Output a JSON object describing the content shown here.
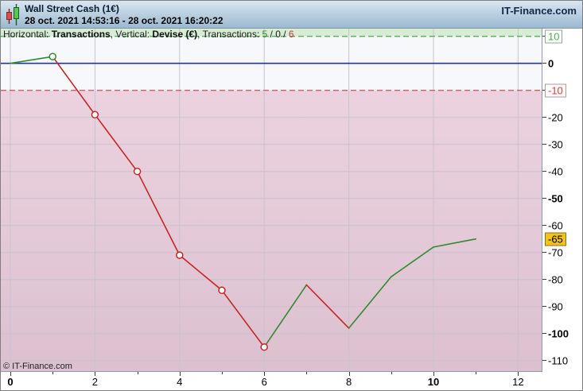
{
  "header": {
    "title": "Wall Street Cash (1€)",
    "date_range": "28 oct. 2021 14:53:16 - 28 oct. 2021 16:20:22",
    "brand": "IT-Finance.com"
  },
  "info_bar": {
    "parts": [
      {
        "text": "Horizontal: ",
        "style": "regular"
      },
      {
        "text": "Transactions",
        "style": "bold"
      },
      {
        "text": ", Vertical: ",
        "style": "regular"
      },
      {
        "text": "Devise (€)",
        "style": "bold"
      },
      {
        "text": ", Transactions: ",
        "style": "regular"
      },
      {
        "text": "5",
        "style": "positive"
      },
      {
        "text": " / ",
        "style": "regular"
      },
      {
        "text": "0",
        "style": "neutral"
      },
      {
        "text": " / ",
        "style": "regular"
      },
      {
        "text": "6",
        "style": "negative"
      }
    ]
  },
  "watermark": "© IT-Finance.com",
  "colors": {
    "band_above_upper": "#d7ecd3",
    "band_middle": "#f6f8fc",
    "band_below_top": "#ecd2df",
    "band_below_bottom": "#dcc0d0",
    "zero_line": "#2232b2",
    "upper_line": "#53b353",
    "lower_line": "#e05c5c",
    "up": "#2e8b2e",
    "down": "#c52525",
    "grid": "#c9c2cc",
    "plot_border": "#8f9aa5",
    "current_value_bg": "#f2c31c",
    "positive_text": "#4cae4c",
    "negative_text": "#cc4444"
  },
  "chart_data": {
    "type": "line",
    "title": "Wall Street Cash (1€)",
    "xlabel": "Transactions",
    "ylabel": "Devise (€)",
    "x": [
      0,
      1,
      2,
      3,
      4,
      5,
      6,
      7,
      8,
      9,
      10,
      11
    ],
    "values": [
      0,
      2.5,
      -19,
      -40,
      -71,
      -84,
      -105,
      -82,
      -98,
      -79,
      -68,
      -65
    ],
    "marker_points": [
      1,
      2,
      3,
      4,
      5,
      6
    ],
    "segment_coloring": "gain-green-loss-red",
    "zero_line": 0,
    "upper_threshold": 10,
    "lower_threshold": -10,
    "current_value": -65,
    "transactions_won": 5,
    "transactions_neutral": 0,
    "transactions_lost": 6,
    "xlim": [
      -0.23,
      12.6
    ],
    "ylim": [
      -114,
      12.9
    ],
    "grid": true,
    "legend": "none",
    "x_gridlines": [
      0,
      2,
      4,
      6,
      8,
      10,
      12
    ],
    "y_gridlines": [
      -20,
      -30,
      -40,
      -50,
      -60,
      -70,
      -80,
      -90,
      -100,
      -110
    ],
    "y_axis_ticks": [
      {
        "label": "10",
        "value": 10,
        "style": "boxed-positive"
      },
      {
        "label": "0",
        "value": 0,
        "style": "bold"
      },
      {
        "label": "-10",
        "value": -10,
        "style": "boxed-negative"
      },
      {
        "label": "-20",
        "value": -20,
        "style": "regular"
      },
      {
        "label": "-30",
        "value": -30,
        "style": "regular"
      },
      {
        "label": "-40",
        "value": -40,
        "style": "regular"
      },
      {
        "label": "-50",
        "value": -50,
        "style": "bold"
      },
      {
        "label": "-60",
        "value": -60,
        "style": "regular"
      },
      {
        "label": "-65",
        "value": -65,
        "style": "current"
      },
      {
        "label": "-70",
        "value": -70,
        "style": "regular"
      },
      {
        "label": "-80",
        "value": -80,
        "style": "regular"
      },
      {
        "label": "-90",
        "value": -90,
        "style": "regular"
      },
      {
        "label": "-100",
        "value": -100,
        "style": "bold"
      },
      {
        "label": "-110",
        "value": -110,
        "style": "regular"
      }
    ],
    "x_axis_ticks": [
      {
        "label": "0",
        "value": 0,
        "style": "bold"
      },
      {
        "label": "2",
        "value": 2,
        "style": "regular"
      },
      {
        "label": "4",
        "value": 4,
        "style": "regular"
      },
      {
        "label": "6",
        "value": 6,
        "style": "regular"
      },
      {
        "label": "8",
        "value": 8,
        "style": "regular"
      },
      {
        "label": "10",
        "value": 10,
        "style": "bold"
      },
      {
        "label": "12",
        "value": 12,
        "style": "regular"
      }
    ],
    "x_minor_ticks": [
      0,
      1,
      2,
      3,
      4,
      5,
      6,
      7,
      8,
      9,
      10,
      11,
      12
    ]
  }
}
